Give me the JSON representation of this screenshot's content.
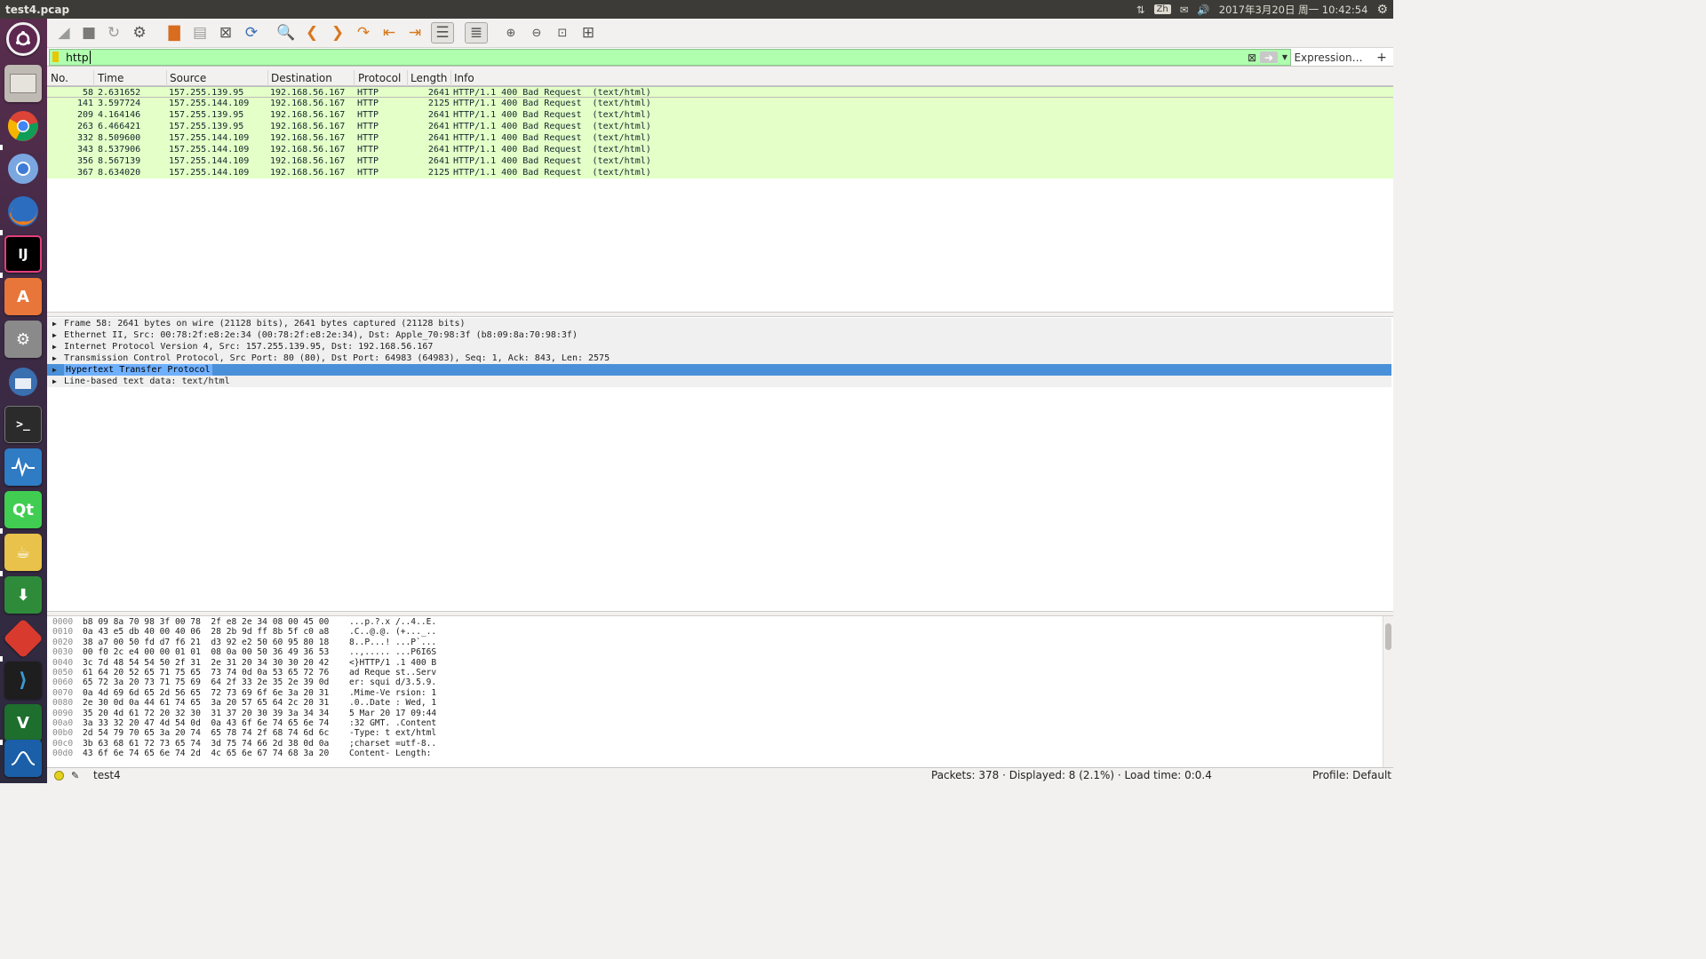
{
  "window": {
    "title": "test4.pcap"
  },
  "tray": {
    "input_method": "Zh",
    "clock": "2017年3月20日 周一 10:42:54"
  },
  "filter": {
    "value": "http",
    "expression_label": "Expression…",
    "add_label": "+"
  },
  "columns": [
    "No.",
    "Time",
    "Source",
    "Destination",
    "Protocol",
    "Length",
    "Info"
  ],
  "packets": [
    {
      "no": "58",
      "time": "2.631652",
      "src": "157.255.139.95",
      "dst": "192.168.56.167",
      "proto": "HTTP",
      "len": "2641",
      "info": "HTTP/1.1 400 Bad Request  (text/html)"
    },
    {
      "no": "141",
      "time": "3.597724",
      "src": "157.255.144.109",
      "dst": "192.168.56.167",
      "proto": "HTTP",
      "len": "2125",
      "info": "HTTP/1.1 400 Bad Request  (text/html)"
    },
    {
      "no": "209",
      "time": "4.164146",
      "src": "157.255.139.95",
      "dst": "192.168.56.167",
      "proto": "HTTP",
      "len": "2641",
      "info": "HTTP/1.1 400 Bad Request  (text/html)"
    },
    {
      "no": "263",
      "time": "6.466421",
      "src": "157.255.139.95",
      "dst": "192.168.56.167",
      "proto": "HTTP",
      "len": "2641",
      "info": "HTTP/1.1 400 Bad Request  (text/html)"
    },
    {
      "no": "332",
      "time": "8.509600",
      "src": "157.255.144.109",
      "dst": "192.168.56.167",
      "proto": "HTTP",
      "len": "2641",
      "info": "HTTP/1.1 400 Bad Request  (text/html)"
    },
    {
      "no": "343",
      "time": "8.537906",
      "src": "157.255.144.109",
      "dst": "192.168.56.167",
      "proto": "HTTP",
      "len": "2641",
      "info": "HTTP/1.1 400 Bad Request  (text/html)"
    },
    {
      "no": "356",
      "time": "8.567139",
      "src": "157.255.144.109",
      "dst": "192.168.56.167",
      "proto": "HTTP",
      "len": "2641",
      "info": "HTTP/1.1 400 Bad Request  (text/html)"
    },
    {
      "no": "367",
      "time": "8.634020",
      "src": "157.255.144.109",
      "dst": "192.168.56.167",
      "proto": "HTTP",
      "len": "2125",
      "info": "HTTP/1.1 400 Bad Request  (text/html)"
    }
  ],
  "details": [
    "Frame 58: 2641 bytes on wire (21128 bits), 2641 bytes captured (21128 bits)",
    "Ethernet II, Src: 00:78:2f:e8:2e:34 (00:78:2f:e8:2e:34), Dst: Apple_70:98:3f (b8:09:8a:70:98:3f)",
    "Internet Protocol Version 4, Src: 157.255.139.95, Dst: 192.168.56.167",
    "Transmission Control Protocol, Src Port: 80 (80), Dst Port: 64983 (64983), Seq: 1, Ack: 843, Len: 2575",
    "Hypertext Transfer Protocol",
    "Line-based text data: text/html"
  ],
  "bytes": [
    {
      "off": "0000",
      "hex": "b8 09 8a 70 98 3f 00 78  2f e8 2e 34 08 00 45 00",
      "ascii": "...p.?.x /..4..E."
    },
    {
      "off": "0010",
      "hex": "0a 43 e5 db 40 00 40 06  28 2b 9d ff 8b 5f c0 a8",
      "ascii": ".C..@.@. (+..._.."
    },
    {
      "off": "0020",
      "hex": "38 a7 00 50 fd d7 f6 21  d3 92 e2 50 60 95 80 18",
      "ascii": "8..P...! ...P`..."
    },
    {
      "off": "0030",
      "hex": "00 f0 2c e4 00 00 01 01  08 0a 00 50 36 49 36 53",
      "ascii": "..,..... ...P6I6S"
    },
    {
      "off": "0040",
      "hex": "3c 7d 48 54 54 50 2f 31  2e 31 20 34 30 30 20 42",
      "ascii": "<}HTTP/1 .1 400 B"
    },
    {
      "off": "0050",
      "hex": "61 64 20 52 65 71 75 65  73 74 0d 0a 53 65 72 76",
      "ascii": "ad Reque st..Serv"
    },
    {
      "off": "0060",
      "hex": "65 72 3a 20 73 71 75 69  64 2f 33 2e 35 2e 39 0d",
      "ascii": "er: squi d/3.5.9."
    },
    {
      "off": "0070",
      "hex": "0a 4d 69 6d 65 2d 56 65  72 73 69 6f 6e 3a 20 31",
      "ascii": ".Mime-Ve rsion: 1"
    },
    {
      "off": "0080",
      "hex": "2e 30 0d 0a 44 61 74 65  3a 20 57 65 64 2c 20 31",
      "ascii": ".0..Date : Wed, 1"
    },
    {
      "off": "0090",
      "hex": "35 20 4d 61 72 20 32 30  31 37 20 30 39 3a 34 34",
      "ascii": "5 Mar 20 17 09:44"
    },
    {
      "off": "00a0",
      "hex": "3a 33 32 20 47 4d 54 0d  0a 43 6f 6e 74 65 6e 74",
      "ascii": ":32 GMT. .Content"
    },
    {
      "off": "00b0",
      "hex": "2d 54 79 70 65 3a 20 74  65 78 74 2f 68 74 6d 6c",
      "ascii": "-Type: t ext/html"
    },
    {
      "off": "00c0",
      "hex": "3b 63 68 61 72 73 65 74  3d 75 74 66 2d 38 0d 0a",
      "ascii": ";charset =utf-8.."
    },
    {
      "off": "00d0",
      "hex": "43 6f 6e 74 65 6e 74 2d  4c 65 6e 67 74 68 3a 20",
      "ascii": "Content- Length: "
    }
  ],
  "status": {
    "file": "test4",
    "packets": "Packets: 378 · Displayed: 8 (2.1%) · Load time: 0:0.4",
    "profile": "Profile: Default"
  },
  "launcher_icons": [
    "ubuntu-dash-icon",
    "files-icon",
    "chrome-icon",
    "chromium-icon",
    "firefox-icon",
    "intellij-icon",
    "software-center-icon",
    "system-settings-icon",
    "thunderbird-icon",
    "terminal-icon",
    "system-monitor-icon",
    "qt-creator-icon",
    "teapot-icon",
    "download-manager-icon",
    "git-icon",
    "vscode-icon",
    "vim-icon",
    "wireshark-icon"
  ],
  "colors": {
    "filter_valid": "#afffaf",
    "http_row": "#e4ffc7",
    "selection": "#4a90d9",
    "topbar": "#3c3b37"
  }
}
